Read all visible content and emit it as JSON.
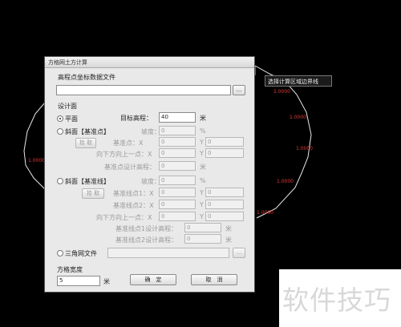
{
  "canvas": {
    "tooltip": "选择计算区域边界线",
    "labels": [
      "1.0000",
      "1.0000",
      "1.0000",
      "1.0000",
      "1.0000",
      "1.0000"
    ]
  },
  "watermark": "软件技巧",
  "dialog": {
    "title": "方格网土方计算",
    "file_section_label": "高程点坐标数据文件",
    "file_path": "",
    "browse_label": "...",
    "design_section_label": "设计面",
    "plane": {
      "label": "平面",
      "selected": true,
      "target_elev_label": "目标高程：",
      "target_elev_value": "40",
      "unit": "米"
    },
    "slope_point": {
      "label": "斜面【基准点】",
      "slope_label": "坡度：",
      "slope_value": "0",
      "slope_unit": "%",
      "pick_label": "拾 取",
      "base_point_label": "基准点：X",
      "base_point_x": "0",
      "base_point_y_label": "Y",
      "base_point_y": "0",
      "direction_label": "向下方向上一点：X",
      "direction_x": "0",
      "direction_y_label": "Y",
      "direction_y": "0",
      "design_elev_label": "基准点设计高程：",
      "design_elev_value": "0",
      "design_elev_unit": "米"
    },
    "slope_line": {
      "label": "斜面【基准线】",
      "slope_label": "坡度：",
      "slope_value": "0",
      "slope_unit": "%",
      "pick_label": "拾 取",
      "line_p1_label": "基准线点1：X",
      "line_p1_x": "0",
      "line_p1_y_label": "Y",
      "line_p1_y": "0",
      "line_p2_label": "基准线点2：X",
      "line_p2_x": "0",
      "line_p2_y_label": "Y",
      "line_p2_y": "0",
      "direction_label": "向下方向上一点：X",
      "direction_x": "0",
      "direction_y_label": "Y",
      "direction_y": "0",
      "p1_elev_label": "基准线点1设计高程：",
      "p1_elev_value": "0",
      "p1_elev_unit": "米",
      "p2_elev_label": "基准线点2设计高程：",
      "p2_elev_value": "0",
      "p2_elev_unit": "米"
    },
    "tin": {
      "label": "三角网文件",
      "path": "",
      "browse_label": "..."
    },
    "grid_width_label": "方格宽度",
    "grid_width_value": "5",
    "grid_width_unit": "米",
    "ok_label": "确　定",
    "cancel_label": "取　消"
  }
}
